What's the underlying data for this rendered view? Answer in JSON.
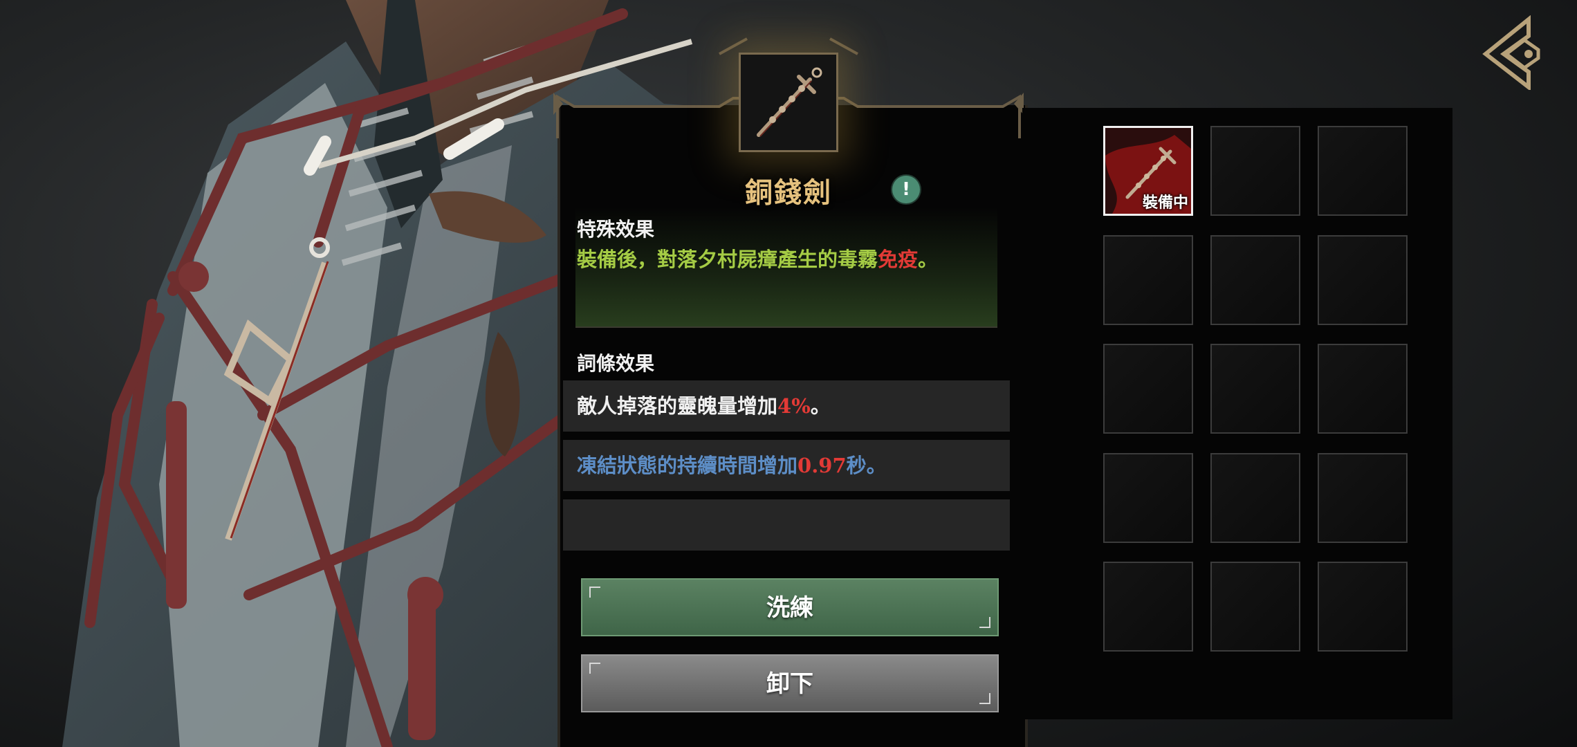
{
  "item": {
    "name": "銅錢劍",
    "icon": "coin-sword-icon"
  },
  "special": {
    "title": "特殊效果",
    "text_before": "裝備後，對落夕村屍瘴產生的毒霧",
    "highlight": "免疫",
    "text_after": "。"
  },
  "affixes": {
    "title": "詞條效果",
    "items": [
      {
        "prefix": "敵人掉落的靈魄量增加",
        "value": "4%",
        "suffix": "。"
      },
      {
        "prefix": "凍結狀態的持續時間增加",
        "value": "0.97",
        "suffix": "秒。"
      }
    ]
  },
  "buttons": {
    "reforge": "洗練",
    "unequip": "卸下"
  },
  "inventory": {
    "equipped_badge": "裝備中",
    "slot_count": 15
  },
  "colors": {
    "item_name": "#e6c27e",
    "special_effect": "#a5cc45",
    "highlight_red": "#e23a36",
    "affix_blue": "#5d8ec7",
    "reforge_button": "#4f7556",
    "unequip_button": "#777777"
  }
}
